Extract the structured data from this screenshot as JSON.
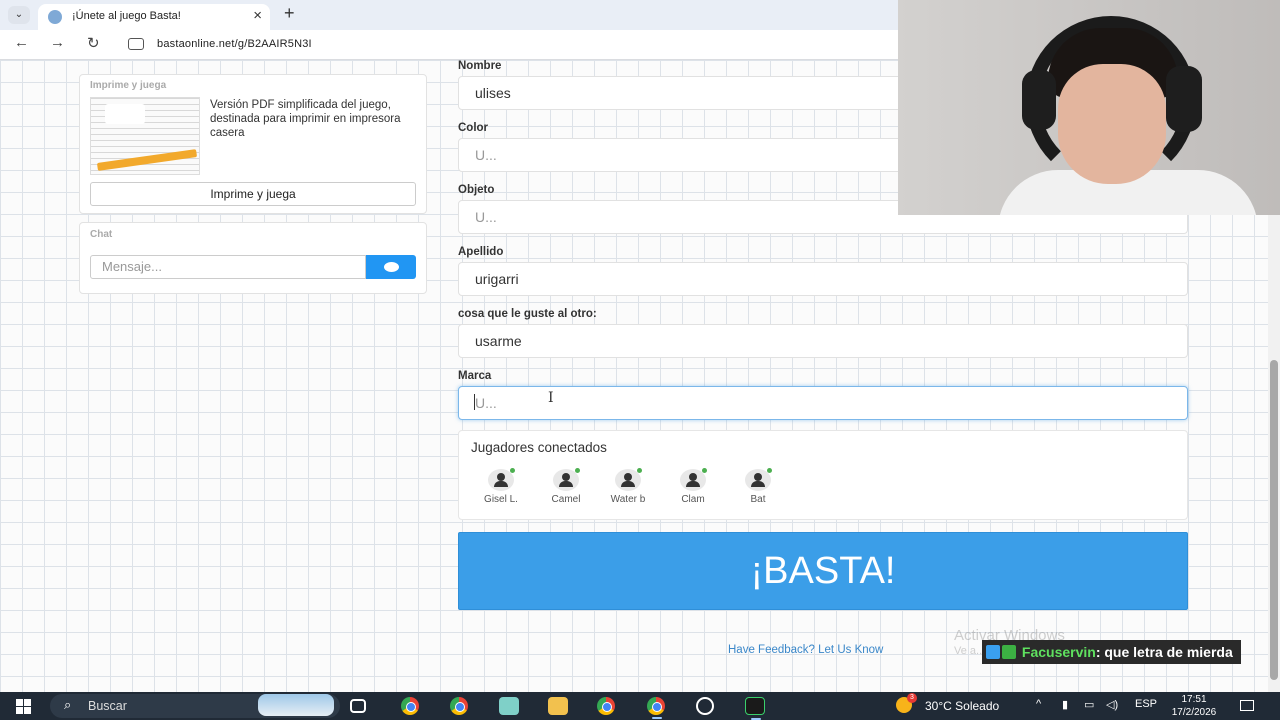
{
  "browser": {
    "tab_title": "¡Únete al juego Basta!",
    "url": "bastaonline.net/g/B2AAIR5N3I"
  },
  "sidebar": {
    "print_panel": {
      "heading": "Imprime y juega",
      "description": "Versión PDF simplificada del juego, destinada para imprimir en impresora casera",
      "button_label": "Imprime y juega"
    },
    "chat_panel": {
      "heading": "Chat",
      "input_placeholder": "Mensaje..."
    }
  },
  "form": {
    "fields": [
      {
        "label": "Nombre",
        "value": "ulises",
        "placeholder": ""
      },
      {
        "label": "Color",
        "value": "",
        "placeholder": "U..."
      },
      {
        "label": "Objeto",
        "value": "",
        "placeholder": "U..."
      },
      {
        "label": "Apellido",
        "value": "urigarri",
        "placeholder": ""
      },
      {
        "label": "cosa que le guste al otro:",
        "value": "usarme",
        "placeholder": ""
      },
      {
        "label": "Marca",
        "value": "",
        "placeholder": "U..."
      }
    ]
  },
  "players": {
    "title": "Jugadores conectados",
    "list": [
      {
        "name": "Gisel L.",
        "icon": "user-icon"
      },
      {
        "name": "Camel",
        "icon": "user-icon"
      },
      {
        "name": "Water b",
        "icon": "user-icon"
      },
      {
        "name": "Clam",
        "icon": "user-star-icon"
      },
      {
        "name": "Bat",
        "icon": "user-icon"
      }
    ],
    "online_color": "#4caf50"
  },
  "basta_button": {
    "label": "¡BASTA!",
    "color": "#3b9ee8"
  },
  "feedback_link": "Have Feedback? Let Us Know",
  "watermark": {
    "line1": "Activar Windows",
    "line2": "Ve a..."
  },
  "stream_chat": {
    "user": "Facuservin",
    "message": ": que letra de mierda"
  },
  "taskbar": {
    "search_placeholder": "Buscar",
    "weather": "30°C  Soleado",
    "weather_badge": "3",
    "language": "ESP",
    "time": "17:51",
    "date": "17/2/2026"
  }
}
